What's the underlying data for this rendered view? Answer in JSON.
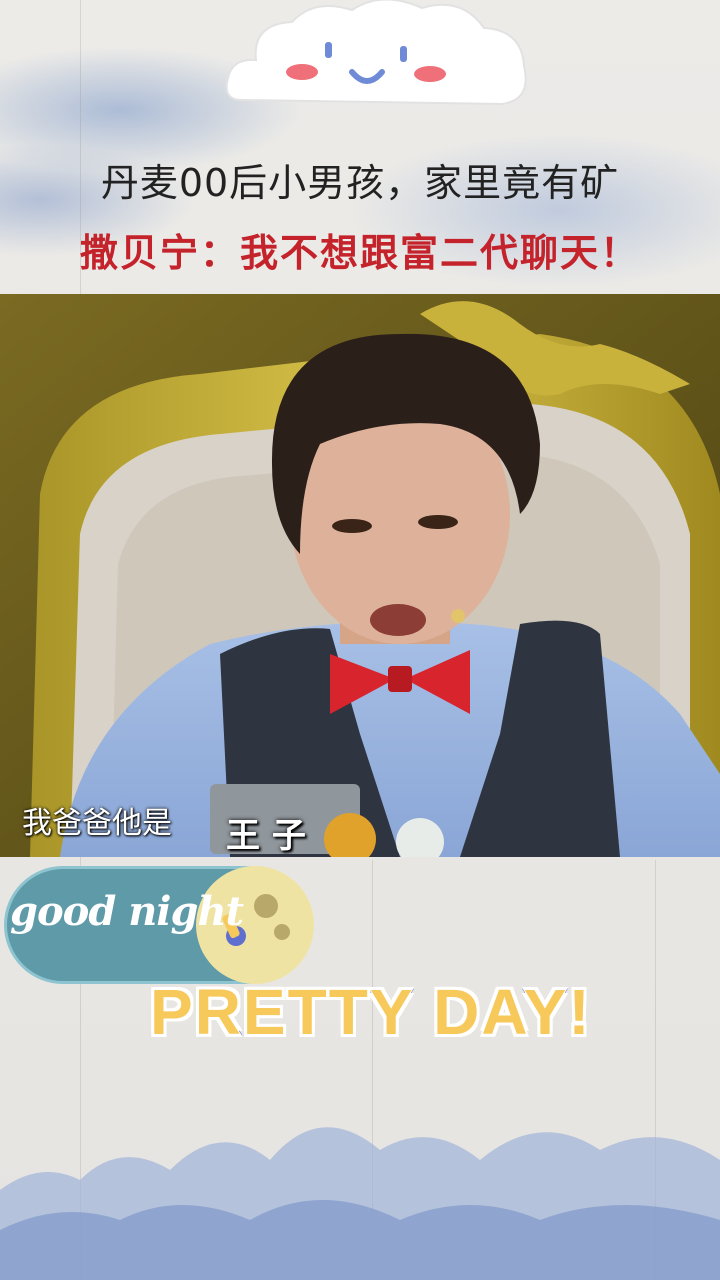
{
  "header": {
    "title_line1": "丹麦00后小男孩，家里竟有矿",
    "title_line2": "撒贝宁：我不想跟富二代聊天！"
  },
  "video": {
    "subtitle": "我爸爸他是",
    "caption_box": "王 子"
  },
  "stickers": {
    "good_night": "good night",
    "pretty_day": "PRETTY DAY!"
  },
  "colors": {
    "title_red": "#c5232b",
    "title_dark": "#222222",
    "pill_teal": "#5e9aa8",
    "pretty_yellow": "#f7c95a",
    "pretty_outline": "#6a6fd8"
  }
}
